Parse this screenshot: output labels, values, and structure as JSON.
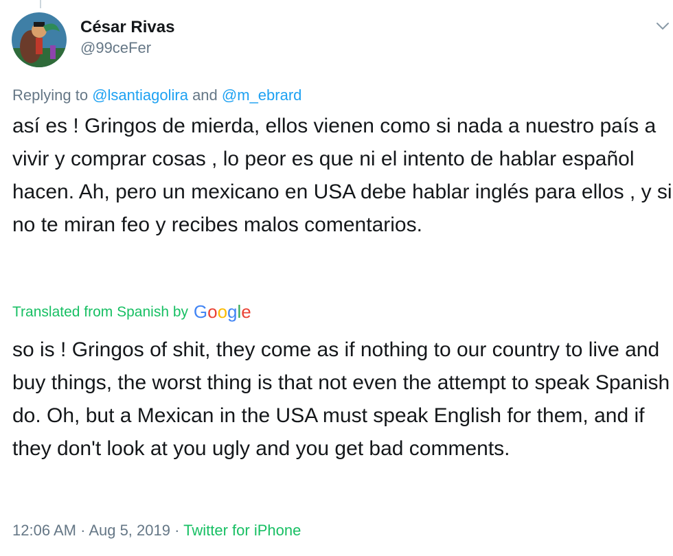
{
  "tweet": {
    "display_name": "César Rivas",
    "handle": "@99ceFer",
    "more_icon": "chevron-down-icon",
    "replying_prefix": "Replying to",
    "replying_user_1": "@lsantiagolira",
    "replying_and": "and",
    "replying_user_2": "@m_ebrard",
    "text_original": "así es ! Gringos de mierda, ellos vienen como si nada a nuestro país a vivir y comprar cosas , lo peor es que ni el intento de hablar español hacen. Ah, pero un mexicano en USA debe hablar inglés para ellos , y si no te miran feo y recibes malos comentarios.",
    "translation_label": "Translated from Spanish by",
    "translation_provider": "Google",
    "text_translated": "so is ! Gringos of shit, they come as if nothing to our country to live and buy things, the worst thing is that not even the attempt to speak Spanish do. Oh, but a Mexican in the USA must speak English for them, and if they don't look at you ugly and you get bad comments.",
    "time": "12:06 AM",
    "date": "Aug 5, 2019",
    "separator": "·",
    "source": "Twitter for iPhone"
  },
  "colors": {
    "text": "#14171a",
    "secondary": "#657786",
    "link": "#1da1f2",
    "translate_green": "#17bf63",
    "google_blue": "#4285f4",
    "google_red": "#ea4335",
    "google_yellow": "#fbbc05",
    "google_green": "#34a853"
  }
}
